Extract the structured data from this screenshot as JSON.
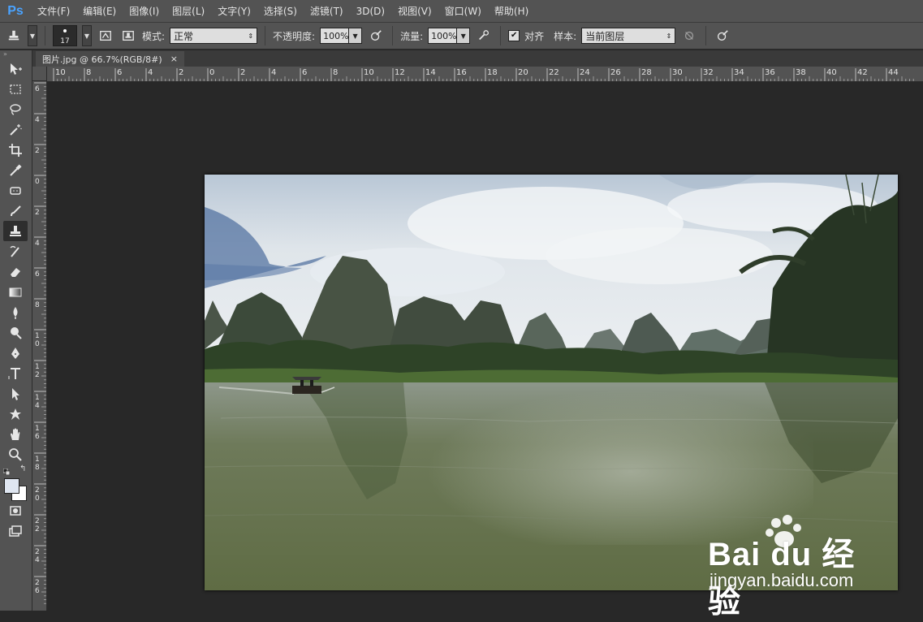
{
  "app": {
    "logo": "Ps"
  },
  "menu": [
    "文件(F)",
    "编辑(E)",
    "图像(I)",
    "图层(L)",
    "文字(Y)",
    "选择(S)",
    "滤镜(T)",
    "3D(D)",
    "视图(V)",
    "窗口(W)",
    "帮助(H)"
  ],
  "options": {
    "brush_size": "17",
    "mode_label": "模式:",
    "mode_value": "正常",
    "opacity_label": "不透明度:",
    "opacity_value": "100%",
    "flow_label": "流量:",
    "flow_value": "100%",
    "align_label": "对齐",
    "align_checked": "✔",
    "sample_label": "样本:",
    "sample_value": "当前图层"
  },
  "document": {
    "tab_title": "图片.jpg @ 66.7%(RGB/8#)",
    "close": "×"
  },
  "rulers": {
    "top": [
      "10",
      "8",
      "6",
      "4",
      "2",
      "0",
      "2",
      "4",
      "6",
      "8",
      "10",
      "12",
      "14",
      "16",
      "18",
      "20",
      "22",
      "24",
      "26",
      "28",
      "30",
      "32",
      "34",
      "36",
      "38",
      "40",
      "42",
      "44"
    ],
    "left": [
      "6",
      "4",
      "2",
      "0",
      "2",
      "4",
      "6",
      "8",
      "10",
      "12",
      "14",
      "16",
      "18",
      "20",
      "22",
      "24",
      "26"
    ]
  },
  "watermark": {
    "main": "Bai du 经验",
    "sub": "jingyan.baidu.com"
  },
  "colors": {
    "accent": "#4aa3ff",
    "panel": "#535353",
    "canvas_bg": "#282828"
  }
}
